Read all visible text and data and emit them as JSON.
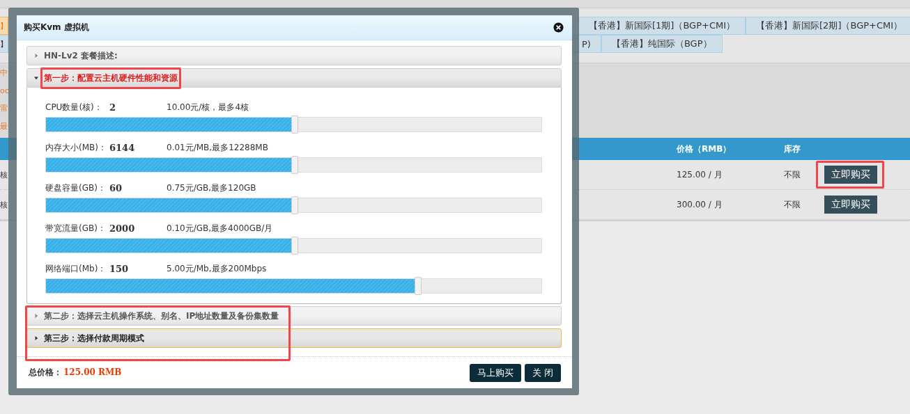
{
  "background_page": {
    "region_tabs": [
      [
        {
          "label": "】",
          "selected": true
        },
        {
          "label": "【香港】新国际[1期]（BGP+CMI）",
          "selected": false
        },
        {
          "label": "【香港】新国际[2期]（BGP+CMI）",
          "selected": false
        }
      ],
      [
        {
          "label": "】",
          "selected": false
        },
        {
          "label": "P)",
          "selected": false
        },
        {
          "label": "【香港】纯国际（BGP）",
          "selected": false
        }
      ]
    ],
    "notes": [
      "中",
      "oc",
      "雷",
      "最"
    ],
    "table": {
      "columns": [
        "价格（RMB）",
        "库存"
      ],
      "rows": [
        {
          "column_1": "核",
          "price": "125.00 / 月",
          "stock": "不限",
          "action": "立即购买",
          "highlighted": true
        },
        {
          "column_1": "核",
          "price": "300.00 / 月",
          "stock": "不限",
          "action": "立即购买",
          "highlighted": false
        }
      ]
    }
  },
  "dialog": {
    "title": "购买Kvm 虚拟机",
    "sections": [
      {
        "title": "HN-Lv2 套餐描述:",
        "expanded": false,
        "active": false,
        "highlighted": false
      },
      {
        "title": "第一步：配置云主机硬件性能和资源",
        "expanded": true,
        "active": false,
        "highlighted": true,
        "options": [
          {
            "label": "CPU数量(核)：",
            "value": "2",
            "price": "10.00元/核，最多4核",
            "level": 0.5
          },
          {
            "label": "内存大小(MB)：",
            "value": "6144",
            "price": "0.01元/MB,最多12288MB",
            "level": 0.5
          },
          {
            "label": "硬盘容量(GB)：",
            "value": "60",
            "price": "0.75元/GB,最多120GB",
            "level": 0.5
          },
          {
            "label": "带宽流量(GB)：",
            "value": "2000",
            "price": "0.10元/GB,最多4000GB/月",
            "level": 0.5
          },
          {
            "label": "网络端口(Mb)：",
            "value": "150",
            "price": "5.00元/Mb,最多200Mbps",
            "level": 0.75
          }
        ]
      },
      {
        "title": "第二步：选择云主机操作系统、别名、IP地址数量及备份集数量",
        "expanded": false,
        "active": false,
        "highlighted": true
      },
      {
        "title": "第三步：选择付款周期模式",
        "expanded": false,
        "active": true,
        "highlighted": true
      }
    ],
    "total_label": "总价格：",
    "total_value": "125.00 RMB",
    "buttons": [
      "马上购买",
      "关 闭"
    ]
  }
}
